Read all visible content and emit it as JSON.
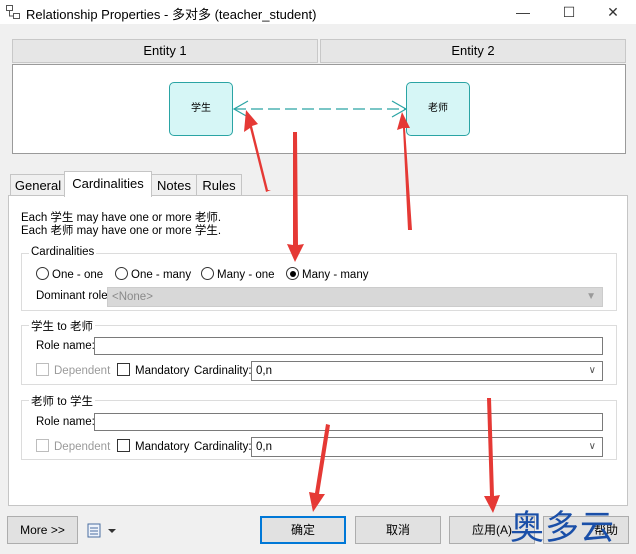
{
  "window": {
    "title": "Relationship Properties - 多对多 (teacher_student)",
    "minimize_glyph": "—",
    "maximize_glyph": "☐",
    "close_glyph": "✕"
  },
  "entities": {
    "entity1_label": "Entity 1",
    "entity2_label": "Entity 2",
    "entity1_name": "学生",
    "entity2_name": "老师"
  },
  "tabs": [
    {
      "label": "General",
      "active": false
    },
    {
      "label": "Cardinalities",
      "active": true
    },
    {
      "label": "Notes",
      "active": false
    },
    {
      "label": "Rules",
      "active": false
    }
  ],
  "cardinalities_tab": {
    "description_line1": "Each 学生 may have one or more 老师.",
    "description_line2": "Each 老师 may have one or more 学生.",
    "group_title": "Cardinalities",
    "options": [
      {
        "label": "One - one",
        "selected": false
      },
      {
        "label": "One - many",
        "selected": false
      },
      {
        "label": "Many - one",
        "selected": false
      },
      {
        "label": "Many - many",
        "selected": true
      }
    ],
    "dominant_role_label": "Dominant role:",
    "dominant_role_value": "<None>",
    "role1": {
      "title": "学生 to 老师",
      "role_name_label": "Role name:",
      "role_name_value": "",
      "dependent_label": "Dependent",
      "mandatory_label": "Mandatory",
      "cardinality_label": "Cardinality:",
      "cardinality_value": "0,n"
    },
    "role2": {
      "title": "老师 to 学生",
      "role_name_label": "Role name:",
      "role_name_value": "",
      "dependent_label": "Dependent",
      "mandatory_label": "Mandatory",
      "cardinality_label": "Cardinality:",
      "cardinality_value": "0,n"
    }
  },
  "footer": {
    "more_label": "More >>",
    "ok_label": "确定",
    "cancel_label": "取消",
    "apply_label": "应用(A)",
    "help_label": "帮助"
  },
  "watermark": "奥多云",
  "colors": {
    "accent": "#0078d7",
    "entity_fill": "#d6f6f6",
    "entity_border": "#2aa4a4",
    "annotation_red": "#e53935"
  }
}
